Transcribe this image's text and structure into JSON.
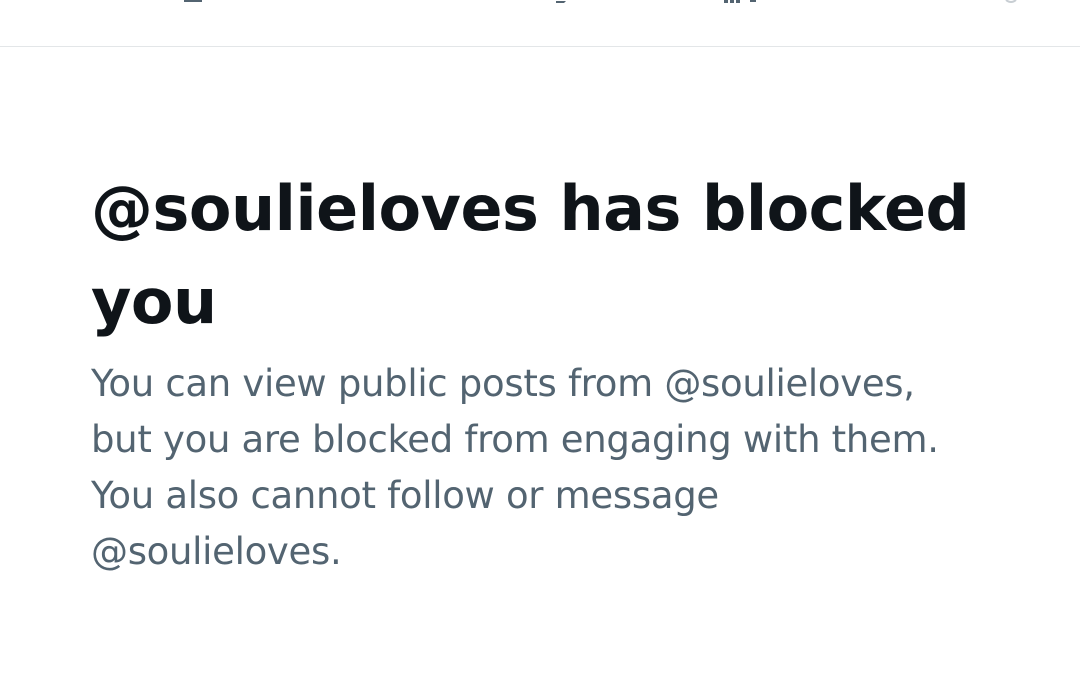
{
  "blocked_notice": {
    "headline": "@soulieloves has blocked you",
    "description": "You can view public posts from @soulieloves, but you are blocked from engaging with them. You also cannot follow or message @soulieloves."
  },
  "colors": {
    "headline_text": "#0f1419",
    "secondary_text": "#536471",
    "divider": "#e3e6e8"
  },
  "icons": {
    "top_bar": [
      "reply-icon",
      "repost-icon",
      "stats-icon",
      "bookmark-star-icon",
      "settings-icon"
    ]
  }
}
